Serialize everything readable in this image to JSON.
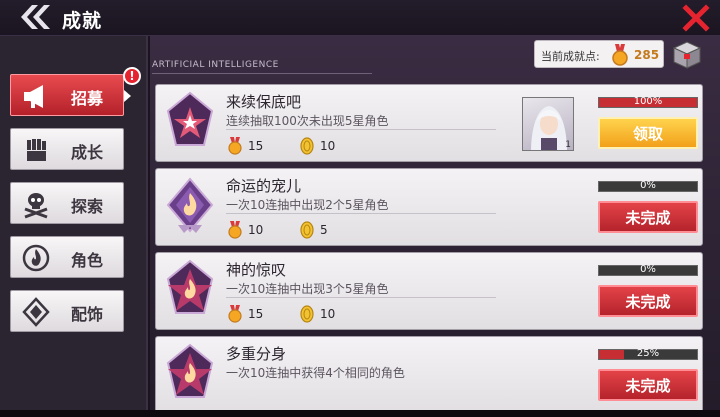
{
  "header": {
    "title": "成就",
    "back_icon": "double-chevron-left-icon",
    "close_icon": "close-x-icon"
  },
  "sidebar": {
    "items": [
      {
        "label": "招募",
        "icon": "megaphone-icon",
        "active": true,
        "badge": "!"
      },
      {
        "label": "成长",
        "icon": "fist-icon",
        "active": false
      },
      {
        "label": "探索",
        "icon": "skull-crossbones-icon",
        "active": false
      },
      {
        "label": "角色",
        "icon": "flame-circle-icon",
        "active": false
      },
      {
        "label": "配饰",
        "icon": "diamond-emblem-icon",
        "active": false
      }
    ]
  },
  "main": {
    "section_en": "ARTIFICIAL INTELLIGENCE",
    "points_label": "当前成就点:",
    "points_value": "285",
    "colors": {
      "accent_red": "#c62e34",
      "claim_gold": "#f2a01a"
    }
  },
  "achievements": [
    {
      "title": "来续保底吧",
      "desc": "连续抽取100次未出现5星角色",
      "reward_points": "15",
      "reward_coins": "10",
      "progress": 1.0,
      "progress_label": "100%",
      "action": "领取",
      "state": "claimable",
      "has_portrait": true,
      "portrait_count": "1",
      "emblem": "star-emblem-icon"
    },
    {
      "title": "命运的宠儿",
      "desc": "一次10连抽中出现2个5星角色",
      "reward_points": "10",
      "reward_coins": "5",
      "progress": 0.0,
      "progress_label": "0%",
      "action": "未完成",
      "state": "incomplete",
      "has_portrait": false,
      "emblem": "flame-diamond-emblem-icon"
    },
    {
      "title": "神的惊叹",
      "desc": "一次10连抽中出现3个5星角色",
      "reward_points": "15",
      "reward_coins": "10",
      "progress": 0.0,
      "progress_label": "0%",
      "action": "未完成",
      "state": "incomplete",
      "has_portrait": false,
      "emblem": "flame-star-emblem-icon"
    },
    {
      "title": "多重分身",
      "desc": "一次10连抽中获得4个相同的角色",
      "reward_points": "",
      "reward_coins": "",
      "progress": 0.25,
      "progress_label": "25%",
      "action": "未完成",
      "state": "incomplete",
      "has_portrait": false,
      "emblem": "flame-star-emblem-icon"
    }
  ]
}
